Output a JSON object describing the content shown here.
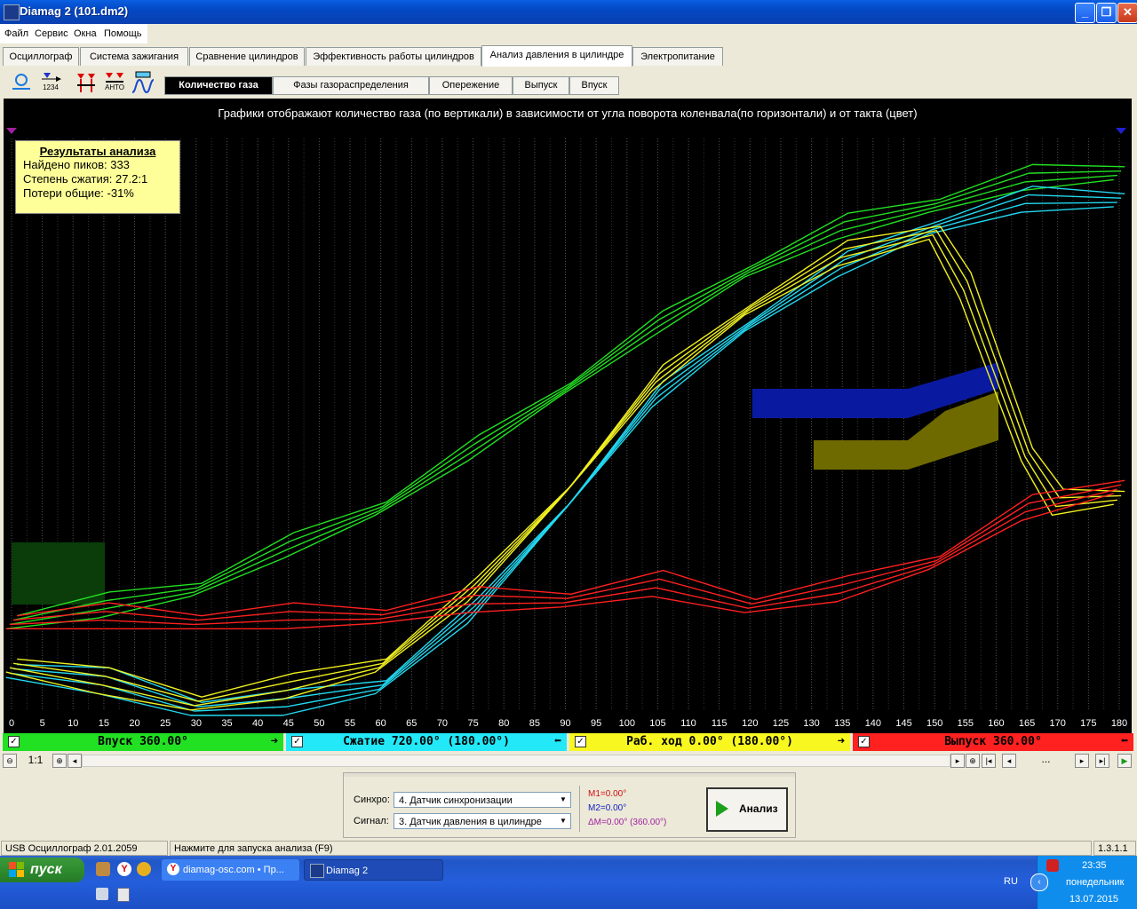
{
  "window": {
    "title": "Diamag 2 (101.dm2)"
  },
  "menu": [
    "Файл",
    "Сервис",
    "Окна",
    "Помощь"
  ],
  "main_tabs": [
    {
      "label": "Осциллограф",
      "active": false
    },
    {
      "label": "Система зажигания",
      "active": false
    },
    {
      "label": "Сравнение цилиндров",
      "active": false
    },
    {
      "label": "Эффективность работы цилиндров",
      "active": false
    },
    {
      "label": "Анализ давления в цилиндре",
      "active": true
    },
    {
      "label": "Электропитание",
      "active": false
    }
  ],
  "toolbar": {
    "icon_label_1": "1234",
    "icon_label_2": "АНТО"
  },
  "sub_tabs": [
    {
      "label": "Количество газа",
      "active": true
    },
    {
      "label": "Фазы газораспределения",
      "active": false
    },
    {
      "label": "Опережение",
      "active": false
    },
    {
      "label": "Выпуск",
      "active": false
    },
    {
      "label": "Впуск",
      "active": false
    }
  ],
  "plot": {
    "title": "Графики отображают количество газа (по вертикали) в зависимости от угла поворота коленвала(по горизонтали) и от такта (цвет)",
    "results": {
      "heading": "Результаты анализа",
      "peaks": "Найдено пиков: 333",
      "compression": "Степень сжатия: 27.2:1",
      "losses": "Потери общие: -31%"
    },
    "x_ticks": [
      "0",
      "5",
      "10",
      "15",
      "20",
      "25",
      "30",
      "35",
      "40",
      "45",
      "50",
      "55",
      "60",
      "65",
      "70",
      "75",
      "80",
      "85",
      "90",
      "95",
      "100",
      "105",
      "110",
      "115",
      "120",
      "125",
      "130",
      "135",
      "140",
      "145",
      "150",
      "155",
      "160",
      "165",
      "170",
      "175",
      "180"
    ]
  },
  "chart_data": {
    "type": "line",
    "xlim": [
      0,
      180
    ],
    "series": [
      {
        "name": "Впуск 360.00°",
        "color": "#22e022",
        "x": [
          0,
          15,
          30,
          45,
          60,
          75,
          90,
          105,
          120,
          135,
          150,
          165,
          180
        ],
        "y": [
          0.12,
          0.14,
          0.18,
          0.25,
          0.33,
          0.43,
          0.55,
          0.66,
          0.77,
          0.84,
          0.89,
          0.93,
          0.95
        ]
      },
      {
        "name": "Сжатие 720.00° (180.00°)",
        "color": "#22d8f0",
        "x": [
          0,
          15,
          30,
          45,
          60,
          75,
          90,
          105,
          120,
          135,
          150,
          165,
          180
        ],
        "y": [
          0.03,
          0.0,
          -0.04,
          -0.04,
          0.0,
          0.13,
          0.33,
          0.53,
          0.67,
          0.77,
          0.85,
          0.89,
          0.9
        ]
      },
      {
        "name": "Раб. ход 0.00° (180.00°)",
        "color": "#f0f020",
        "x": [
          0,
          15,
          30,
          45,
          60,
          75,
          90,
          105,
          120,
          135,
          150,
          155,
          165,
          170,
          180
        ],
        "y": [
          0.04,
          0.0,
          -0.03,
          -0.01,
          0.04,
          0.17,
          0.36,
          0.56,
          0.7,
          0.79,
          0.84,
          0.73,
          0.43,
          0.33,
          0.35
        ]
      },
      {
        "name": "Выпуск 360.00°",
        "color": "#ff2020",
        "x": [
          0,
          15,
          30,
          45,
          60,
          75,
          90,
          105,
          120,
          135,
          150,
          165,
          180
        ],
        "y": [
          0.12,
          0.12,
          0.12,
          0.12,
          0.13,
          0.15,
          0.16,
          0.18,
          0.15,
          0.17,
          0.23,
          0.32,
          0.37
        ]
      }
    ],
    "grid": true,
    "background": "#000000"
  },
  "phases": [
    {
      "label": "Впуск 360.00°",
      "color": "#22e022",
      "checked": "✓"
    },
    {
      "label": "Сжатие 720.00° (180.00°)",
      "color": "#22e8f8",
      "checked": "✓"
    },
    {
      "label": "Раб. ход 0.00° (180.00°)",
      "color": "#f8f820",
      "checked": "✓"
    },
    {
      "label": "Выпуск 360.00°",
      "color": "#ff2020",
      "checked": "✓"
    }
  ],
  "scroll": {
    "zoom": "1:1",
    "position": "..."
  },
  "controls": {
    "sync_label": "Синхро:",
    "sync_value": "4.  Датчик синхронизации",
    "signal_label": "Сигнал:",
    "signal_value": "3.  Датчик давления в цилиндре",
    "m1": "M1=0.00°",
    "m2": "M2=0.00°",
    "dm": "ΔM=0.00° (360.00°)",
    "analyze_label": "Анализ"
  },
  "statusbar": {
    "device": "USB Осциллограф  2.01.2059",
    "hint": "Нажмите для запуска анализа (F9)",
    "version": "1.3.1.1"
  },
  "taskbar": {
    "start": "пуск",
    "tasks": [
      "diamag-osc.com • Пр...",
      "Diamag 2"
    ],
    "lang": "RU",
    "time": "23:35",
    "day": "понедельник",
    "date": "13.07.2015"
  }
}
